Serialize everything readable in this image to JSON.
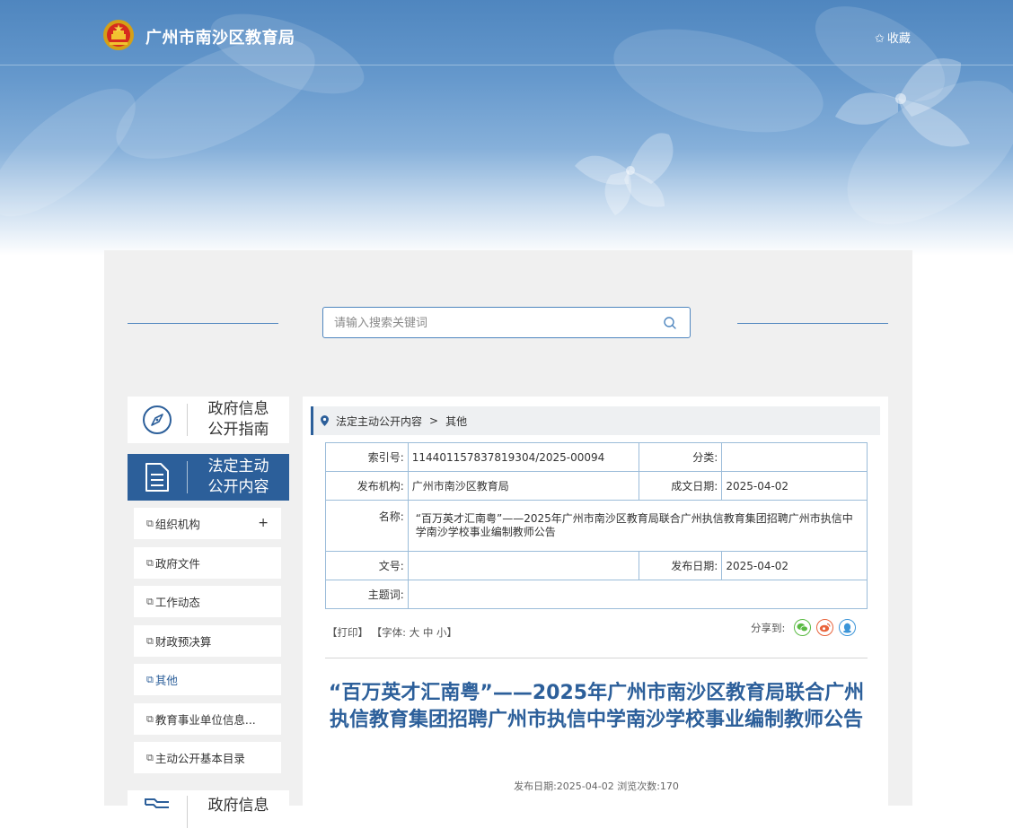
{
  "header": {
    "site_title": "广州市南沙区教育局",
    "favorite_label": "收藏"
  },
  "search": {
    "placeholder": "请输入搜索关键词",
    "value": ""
  },
  "sidebar": {
    "sections": [
      {
        "label": "政府信息\n公开指南",
        "icon": "compass-icon",
        "active": false
      },
      {
        "label": "法定主动\n公开内容",
        "icon": "document-icon",
        "active": true
      },
      {
        "label": "政府信息",
        "icon": "folder-icon",
        "active": false
      }
    ],
    "items": [
      {
        "label": "组织机构",
        "expand": "+"
      },
      {
        "label": "政府文件"
      },
      {
        "label": "工作动态"
      },
      {
        "label": "财政预决算"
      },
      {
        "label": "其他",
        "active": true
      },
      {
        "label": "教育事业单位信息..."
      },
      {
        "label": "主动公开基本目录"
      }
    ]
  },
  "breadcrumb": {
    "items": [
      "法定主动公开内容",
      "其他"
    ],
    "separator": ">"
  },
  "meta": {
    "index_label": "索引号:",
    "index_value": "114401157837819304/2025-00094",
    "category_label": "分类:",
    "category_value": "",
    "publisher_label": "发布机构:",
    "publisher_value": "广州市南沙区教育局",
    "created_label": "成文日期:",
    "created_value": "2025-04-02",
    "name_label": "名称:",
    "name_value": "“百万英才汇南粤”——2025年广州市南沙区教育局联合广州执信教育集团招聘广州市执信中学南沙学校事业编制教师公告",
    "docno_label": "文号:",
    "docno_value": "",
    "pubdate_label": "发布日期:",
    "pubdate_value": "2025-04-02",
    "subject_label": "主题词:",
    "subject_value": ""
  },
  "tools": {
    "print": "【打印】",
    "font_prefix": "【字体:",
    "font_large": "大",
    "font_medium": "中",
    "font_small": "小】",
    "share_label": "分享到:"
  },
  "article": {
    "title": "“百万英才汇南粤”——2025年广州市南沙区教育局联合广州执信教育集团招聘广州市执信中学南沙学校事业编制教师公告",
    "pub_info": "发布日期:2025-04-02  浏览次数:170"
  },
  "colors": {
    "primary": "#2c5f9a",
    "border": "#9bbcd9",
    "wechat": "#5aba43",
    "weibo": "#e8643c",
    "qq": "#3c95d8"
  }
}
